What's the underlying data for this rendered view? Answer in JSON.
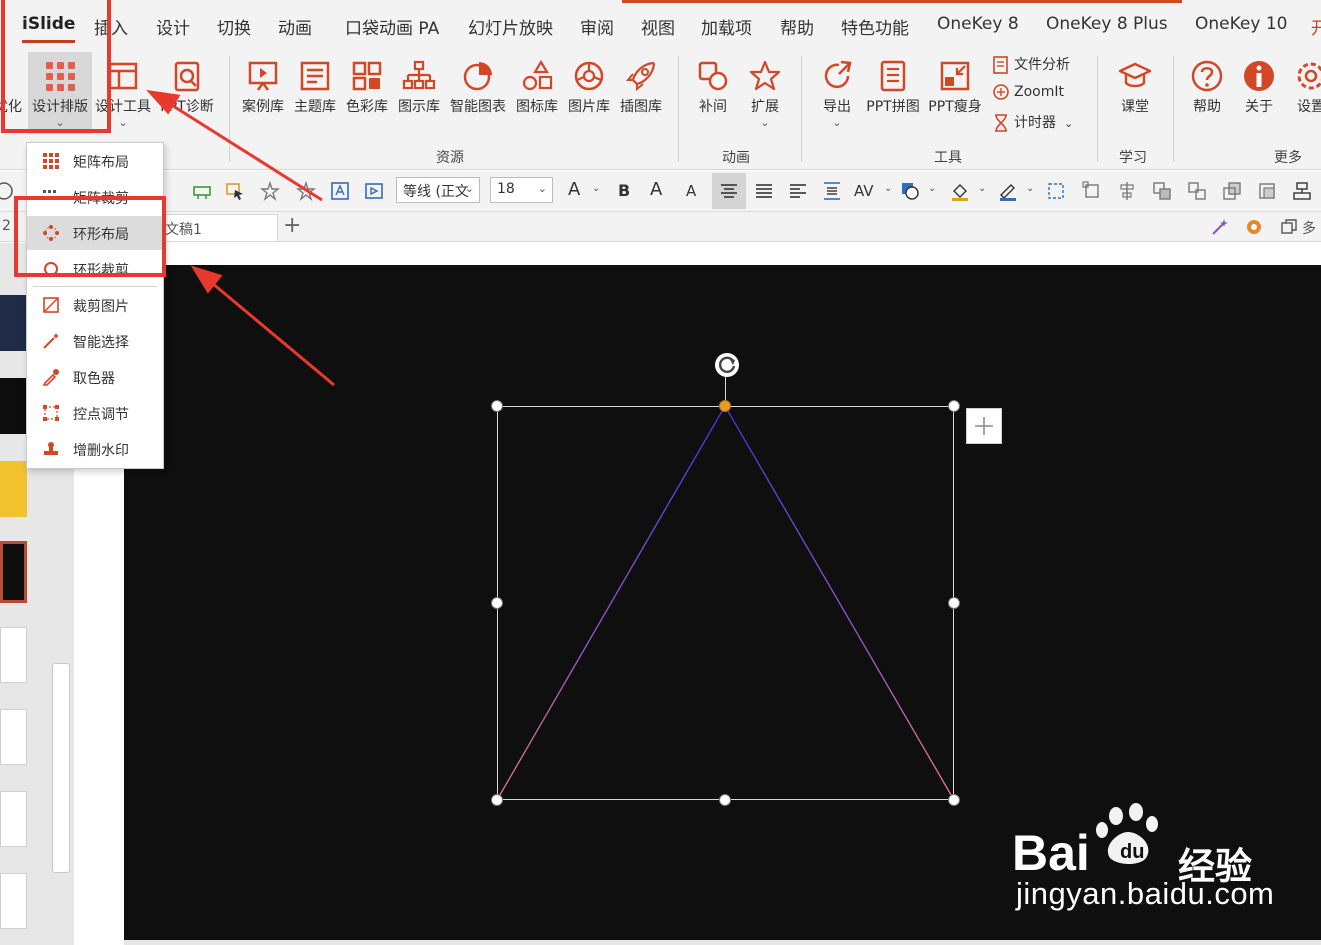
{
  "menubar": {
    "tabs": [
      "iSlide",
      "插入",
      "设计",
      "切换",
      "动画",
      "口袋动画 PA",
      "幻灯片放映",
      "审阅",
      "视图",
      "加载项",
      "帮助",
      "特色功能",
      "OneKey 8",
      "OneKey 8 Plus",
      "OneKey 10",
      "开"
    ],
    "active_tab": "iSlide"
  },
  "ribbon": {
    "left_cut": "优化",
    "design_layout": "设计排版",
    "design_tools": "设计工具",
    "ppt_diagnose": "PPT诊断",
    "resources": [
      "案例库",
      "主题库",
      "色彩库",
      "图示库",
      "智能图表",
      "图标库",
      "图片库",
      "插图库"
    ],
    "tween": "补间",
    "extend": "扩展",
    "export": "导出",
    "ppt_collage": "PPT拼图",
    "ppt_slim": "PPT瘦身",
    "file_analysis": "文件分析",
    "zoomit": "ZoomIt",
    "timer": "计时器",
    "course": "课堂",
    "help": "帮助",
    "about": "关于",
    "settings": "设置",
    "groups": {
      "resources": "资源",
      "animation": "动画",
      "tools": "工具",
      "learn": "学习",
      "more": "更多"
    },
    "caret": "⌄"
  },
  "format_bar": {
    "font_name": "等线 (正文",
    "font_size": "18",
    "font_color_letter": "A",
    "bold": "B",
    "grow": "A",
    "shrink": "A",
    "spacing": "AV"
  },
  "doc_tabs": {
    "left_cut": "2",
    "active_doc": "文稿1",
    "add": "+",
    "right_label": "多"
  },
  "dropdown": {
    "items": [
      "矩阵布局",
      "矩阵裁剪",
      "环形布局",
      "环形裁剪",
      "裁剪图片",
      "智能选择",
      "取色器",
      "控点调节",
      "增删水印"
    ],
    "hovered": "环形布局"
  },
  "watermark": {
    "logo": "Bai",
    "logo_du": "du",
    "cn": "经验",
    "url": "jingyan.baidu.com"
  },
  "colors": {
    "accent": "#c43e1c",
    "annotation": "#e8392f",
    "slide_bg": "#0f0f0f",
    "triangle_top": "#4a35e8",
    "triangle_bottom": "#f07a7a"
  }
}
